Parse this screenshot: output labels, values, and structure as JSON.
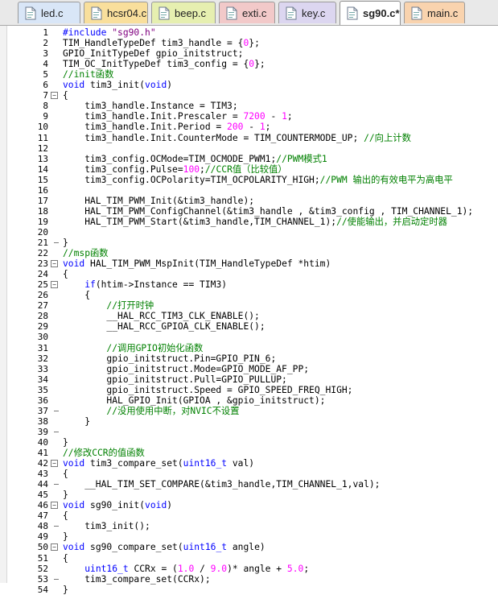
{
  "tabs": [
    {
      "label": "led.c",
      "color": "#d9e6f7"
    },
    {
      "label": "hcsr04.c",
      "color": "#f9df9c"
    },
    {
      "label": "beep.c",
      "color": "#e6efb0"
    },
    {
      "label": "exti.c",
      "color": "#f2c9c9"
    },
    {
      "label": "key.c",
      "color": "#dcd6f0"
    },
    {
      "label": "sg90.c*",
      "color": "#ffffff",
      "active": true
    },
    {
      "label": "main.c",
      "color": "#f9d3ae"
    }
  ],
  "fold_markers": {
    "7": "start",
    "21": "end",
    "23": "start",
    "24": "inner",
    "25": "start",
    "37": "end",
    "39": "end",
    "42": "start",
    "44": "end",
    "46": "start",
    "48": "end",
    "50": "start",
    "53": "end"
  },
  "lines": [
    {
      "n": "1",
      "text": "#include \"sg90.h\""
    },
    {
      "n": "2",
      "text": "TIM_HandleTypeDef tim3_handle = {0};"
    },
    {
      "n": "3",
      "text": "GPIO_InitTypeDef gpio_initstruct;"
    },
    {
      "n": "4",
      "text": "TIM_OC_InitTypeDef tim3_config = {0};"
    },
    {
      "n": "5",
      "text": "//init函数"
    },
    {
      "n": "6",
      "text": "void tim3_init(void)"
    },
    {
      "n": "7",
      "text": "{"
    },
    {
      "n": "8",
      "text": "    tim3_handle.Instance = TIM3;"
    },
    {
      "n": "9",
      "text": "    tim3_handle.Init.Prescaler = 7200 - 1;"
    },
    {
      "n": "10",
      "text": "    tim3_handle.Init.Period = 200 - 1;"
    },
    {
      "n": "11",
      "text": "    tim3_handle.Init.CounterMode = TIM_COUNTERMODE_UP; //向上计数"
    },
    {
      "n": "12",
      "text": "    "
    },
    {
      "n": "13",
      "text": "    tim3_config.OCMode=TIM_OCMODE_PWM1;//PWM模式1"
    },
    {
      "n": "14",
      "text": "    tim3_config.Pulse=100;//CCR值（比较值）"
    },
    {
      "n": "15",
      "text": "    tim3_config.OCPolarity=TIM_OCPOLARITY_HIGH;//PWM 输出的有效电平为高电平"
    },
    {
      "n": "16",
      "text": "    "
    },
    {
      "n": "17",
      "text": "    HAL_TIM_PWM_Init(&tim3_handle);"
    },
    {
      "n": "18",
      "text": "    HAL_TIM_PWM_ConfigChannel(&tim3_handle , &tim3_config , TIM_CHANNEL_1);"
    },
    {
      "n": "19",
      "text": "    HAL_TIM_PWM_Start(&tim3_handle,TIM_CHANNEL_1);//使能输出，并启动定时器"
    },
    {
      "n": "20",
      "text": "    "
    },
    {
      "n": "21",
      "text": "}"
    },
    {
      "n": "22",
      "text": "//msp函数"
    },
    {
      "n": "23",
      "text": "void HAL_TIM_PWM_MspInit(TIM_HandleTypeDef *htim)"
    },
    {
      "n": "24",
      "text": "{"
    },
    {
      "n": "25",
      "text": "    if(htim->Instance == TIM3)"
    },
    {
      "n": "26",
      "text": "    {"
    },
    {
      "n": "27",
      "text": "        //打开时钟"
    },
    {
      "n": "28",
      "text": "        __HAL_RCC_TIM3_CLK_ENABLE();"
    },
    {
      "n": "29",
      "text": "        __HAL_RCC_GPIOA_CLK_ENABLE();"
    },
    {
      "n": "30",
      "text": ""
    },
    {
      "n": "31",
      "text": "        //调用GPIO初始化函数"
    },
    {
      "n": "32",
      "text": "        gpio_initstruct.Pin=GPIO_PIN_6;"
    },
    {
      "n": "33",
      "text": "        gpio_initstruct.Mode=GPIO_MODE_AF_PP;"
    },
    {
      "n": "34",
      "text": "        gpio_initstruct.Pull=GPIO_PULLUP;"
    },
    {
      "n": "35",
      "text": "        gpio_initstruct.Speed = GPIO_SPEED_FREQ_HIGH;"
    },
    {
      "n": "36",
      "text": "        HAL_GPIO_Init(GPIOA , &gpio_initstruct);"
    },
    {
      "n": "37",
      "text": "        //没用使用中断，对NVIC不设置"
    },
    {
      "n": "38",
      "text": "    }"
    },
    {
      "n": "39",
      "text": "    "
    },
    {
      "n": "40",
      "text": "}"
    },
    {
      "n": "41",
      "text": "//修改CCR的值函数"
    },
    {
      "n": "42",
      "text": "void tim3_compare_set(uint16_t val)"
    },
    {
      "n": "43",
      "text": "{"
    },
    {
      "n": "44",
      "text": "    __HAL_TIM_SET_COMPARE(&tim3_handle,TIM_CHANNEL_1,val);"
    },
    {
      "n": "45",
      "text": "}"
    },
    {
      "n": "46",
      "text": "void sg90_init(void)"
    },
    {
      "n": "47",
      "text": "{"
    },
    {
      "n": "48",
      "text": "    tim3_init();"
    },
    {
      "n": "49",
      "text": "}"
    },
    {
      "n": "50",
      "text": "void sg90_compare_set(uint16_t angle)"
    },
    {
      "n": "51",
      "text": "{"
    },
    {
      "n": "52",
      "text": "    uint16_t CCRx = (1.0 / 9.0)* angle + 5.0;"
    },
    {
      "n": "53",
      "text": "    tim3_compare_set(CCRx);"
    },
    {
      "n": "54",
      "text": "}"
    }
  ],
  "colors": {
    "keyword": "#0000ff",
    "comment": "#008000",
    "number": "#ff00ff",
    "string": "#800080",
    "text": "#000000"
  }
}
